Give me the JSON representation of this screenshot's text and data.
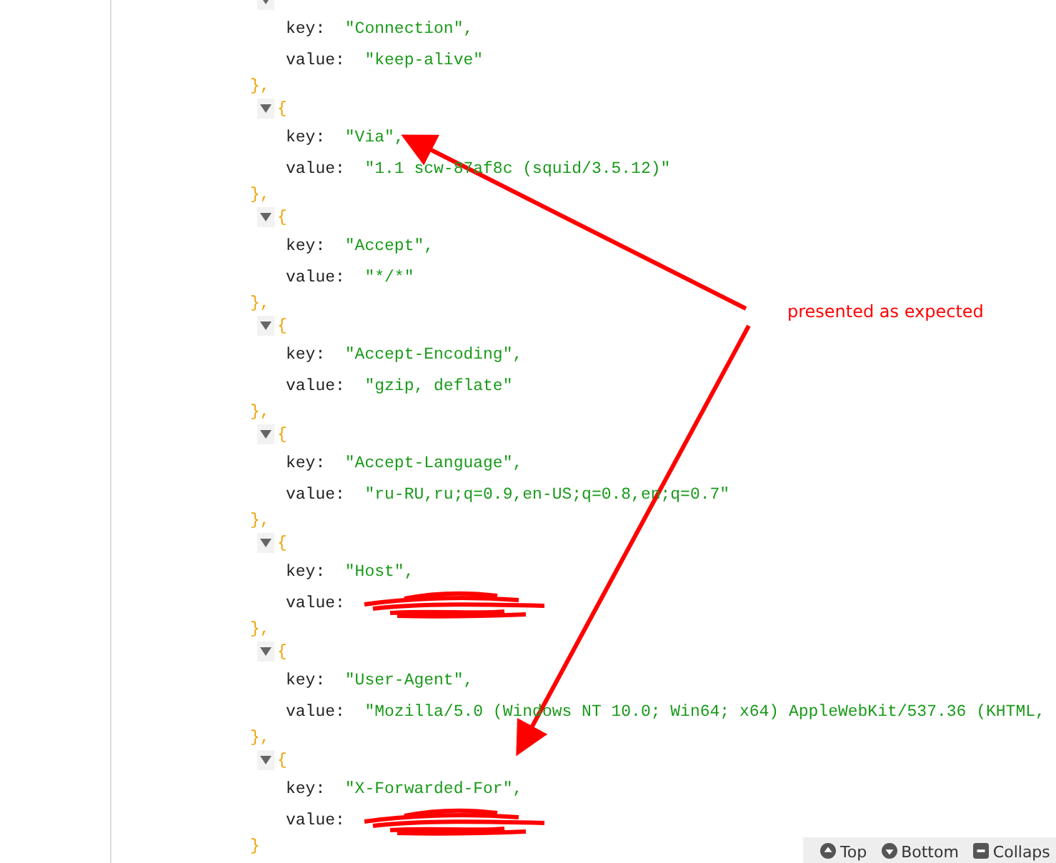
{
  "entries": [
    {
      "expanded": true,
      "key_label": "key:",
      "key": "\"Connection\",",
      "value_label": "value:",
      "value": "\"keep-alive\"",
      "close": "},"
    },
    {
      "expanded": true,
      "open": "{",
      "key_label": "key:",
      "key": "\"Via\",",
      "value_label": "value:",
      "value": "\"1.1 scw-87af8c (squid/3.5.12)\"",
      "close": "},"
    },
    {
      "expanded": true,
      "open": "{",
      "key_label": "key:",
      "key": "\"Accept\",",
      "value_label": "value:",
      "value": "\"*/*\"",
      "close": "},"
    },
    {
      "expanded": true,
      "open": "{",
      "key_label": "key:",
      "key": "\"Accept-Encoding\",",
      "value_label": "value:",
      "value": "\"gzip, deflate\"",
      "close": "},"
    },
    {
      "expanded": true,
      "open": "{",
      "key_label": "key:",
      "key": "\"Accept-Language\",",
      "value_label": "value:",
      "value": "\"ru-RU,ru;q=0.9,en-US;q=0.8,en;q=0.7\"",
      "close": "},"
    },
    {
      "expanded": true,
      "open": "{",
      "key_label": "key:",
      "key": "\"Host\",",
      "value_label": "value:",
      "close": "},"
    },
    {
      "expanded": true,
      "open": "{",
      "key_label": "key:",
      "key": "\"User-Agent\",",
      "value_label": "value:",
      "value": "\"Mozilla/5.0 (Windows NT 10.0; Win64; x64) AppleWebKit/537.36 (KHTML,",
      "close": "},"
    },
    {
      "expanded": true,
      "open": "{",
      "key_label": "key:",
      "key": "\"X-Forwarded-For\",",
      "value_label": "value:",
      "close": "}"
    }
  ],
  "annotation": {
    "text": "presented as expected"
  },
  "toolbar": [
    {
      "kind": "top",
      "label": "Top"
    },
    {
      "kind": "bottom",
      "label": "Bottom"
    },
    {
      "kind": "collapse",
      "label": "Collaps"
    }
  ]
}
